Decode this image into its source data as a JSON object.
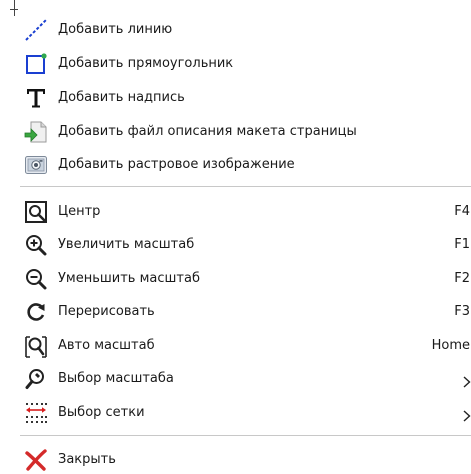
{
  "menu": {
    "add_items": [
      {
        "label": "Добавить линию",
        "icon": "line-icon"
      },
      {
        "label": "Добавить прямоугольник",
        "icon": "rectangle-icon"
      },
      {
        "label": "Добавить надпись",
        "icon": "text-icon"
      },
      {
        "label": "Добавить файл описания макета страницы",
        "icon": "layout-file-icon"
      },
      {
        "label": "Добавить растровое изображение",
        "icon": "image-icon"
      }
    ],
    "view_items": [
      {
        "label": "Центр",
        "shortcut": "F4",
        "icon": "center-icon"
      },
      {
        "label": "Увеличить масштаб",
        "shortcut": "F1",
        "icon": "zoom-in-icon"
      },
      {
        "label": "Уменьшить масштаб",
        "shortcut": "F2",
        "icon": "zoom-out-icon"
      },
      {
        "label": "Перерисовать",
        "shortcut": "F3",
        "icon": "redraw-icon"
      },
      {
        "label": "Авто масштаб",
        "shortcut": "Home",
        "icon": "auto-zoom-icon"
      },
      {
        "label": "Выбор масштаба",
        "icon": "zoom-select-icon",
        "submenu": true
      },
      {
        "label": "Выбор сетки",
        "icon": "grid-select-icon",
        "submenu": true
      }
    ],
    "close_item": {
      "label": "Закрыть",
      "icon": "close-icon"
    }
  },
  "colors": {
    "line_blue": "#1a3fd1",
    "rect_green": "#2fa84f",
    "arrow_green": "#3aa640",
    "grid_red": "#d81e1e",
    "close_red": "#d42a2a",
    "separator": "#c8c8c8"
  }
}
